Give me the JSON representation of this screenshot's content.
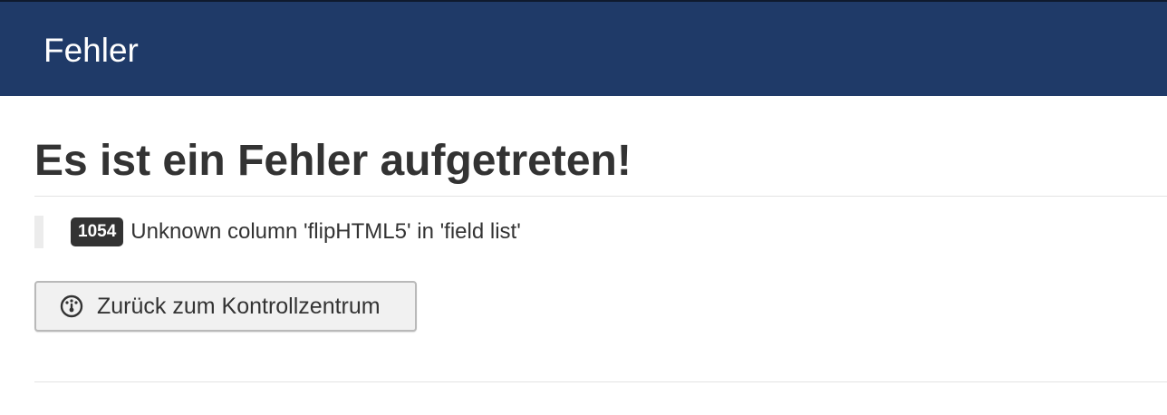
{
  "header": {
    "title": "Fehler",
    "background_color": "#1f3a68"
  },
  "main": {
    "heading": "Es ist ein Fehler aufgetreten!",
    "error": {
      "code": "1054",
      "message": "Unknown column 'flipHTML5' in 'field list'"
    },
    "back_button": {
      "label": "Zurück zum Kontrollzentrum",
      "icon": "dashboard-icon"
    }
  }
}
